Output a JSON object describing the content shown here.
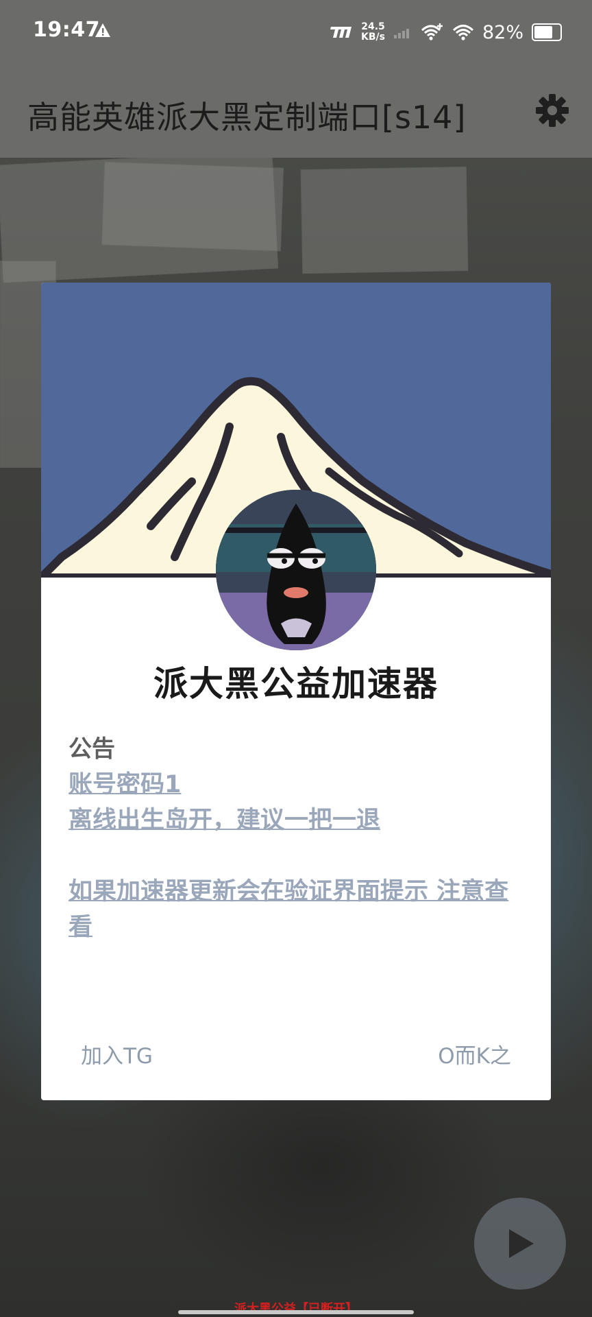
{
  "status_bar": {
    "time": "19:47",
    "net_speed_value": "24.5",
    "net_speed_unit": "KB/s",
    "battery_percent": "82%",
    "battery_level": 0.82
  },
  "app_bar": {
    "title": "高能英雄派大黑定制端口[s14]"
  },
  "dialog": {
    "title": "派大黑公益加速器",
    "notice_heading": "公告",
    "notice_lines": [
      "账号密码1",
      "离线出生岛开，建议一把一退",
      "",
      "如果加速器更新会在验证界面提示 注意查看"
    ],
    "buttons": {
      "left": "加入TG",
      "right": "O而K之"
    }
  },
  "footer": {
    "status_text": "派大黑公益【已断开】"
  },
  "colors": {
    "banner": "#50699a",
    "status_text": "#d62020",
    "link_text": "#9aa6ba"
  }
}
